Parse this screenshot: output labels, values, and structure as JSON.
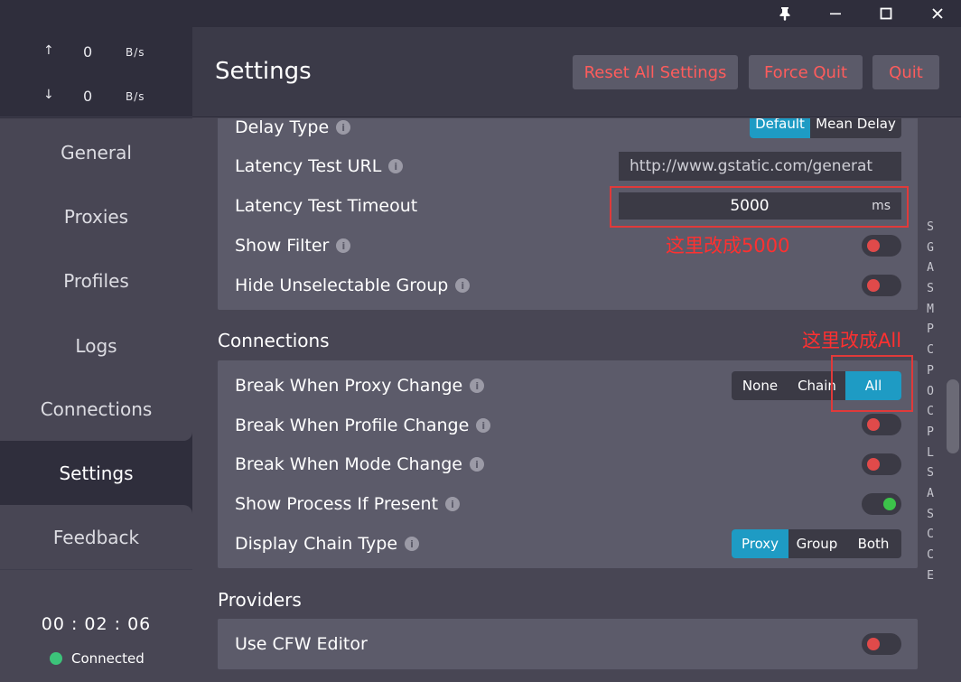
{
  "window": {
    "pin_icon": "pin-icon",
    "minimize_icon": "minimize-icon",
    "maximize_icon": "maximize-icon",
    "close_icon": "close-icon"
  },
  "speed": {
    "upload_arrow": "↑",
    "upload_value": "0",
    "upload_unit": "B/s",
    "download_arrow": "↓",
    "download_value": "0",
    "download_unit": "B/s"
  },
  "nav": {
    "items": [
      "General",
      "Proxies",
      "Profiles",
      "Logs",
      "Connections",
      "Settings",
      "Feedback"
    ],
    "active": "Settings"
  },
  "status": {
    "timer": "00 : 02 : 06",
    "connection": "Connected"
  },
  "header": {
    "title": "Settings",
    "reset_label": "Reset All Settings",
    "force_quit_label": "Force Quit",
    "quit_label": "Quit"
  },
  "general_settings": {
    "delay_type_label": "Delay Type",
    "delay_type_options": [
      "Default",
      "Mean Delay"
    ],
    "delay_type_selected": "Default",
    "latency_url_label": "Latency Test URL",
    "latency_url_value": "http://www.gstatic.com/generat",
    "latency_timeout_label": "Latency Test Timeout",
    "latency_timeout_value": "5000",
    "latency_timeout_unit": "ms",
    "show_filter_label": "Show Filter",
    "show_filter_on": false,
    "hide_unselectable_label": "Hide Unselectable Group",
    "hide_unselectable_on": false
  },
  "connections": {
    "title": "Connections",
    "break_proxy_label": "Break When Proxy Change",
    "break_proxy_options": [
      "None",
      "Chain",
      "All"
    ],
    "break_proxy_selected": "All",
    "break_profile_label": "Break When Profile Change",
    "break_profile_on": false,
    "break_mode_label": "Break When Mode Change",
    "break_mode_on": false,
    "show_process_label": "Show Process If Present",
    "show_process_on": true,
    "chain_type_label": "Display Chain Type",
    "chain_type_options": [
      "Proxy",
      "Group",
      "Both"
    ],
    "chain_type_selected": "Proxy"
  },
  "providers": {
    "title": "Providers",
    "cfw_editor_label": "Use CFW Editor",
    "cfw_editor_on": false
  },
  "annotations": {
    "timeout_note": "这里改成5000",
    "break_note": "这里改成All"
  },
  "index_letters": [
    "S",
    "G",
    "A",
    "S",
    "M",
    "P",
    "C",
    "P",
    "O",
    "C",
    "P",
    "L",
    "S",
    "A",
    "S",
    "C",
    "C",
    "E"
  ],
  "colors": {
    "accent": "#1e9bc4",
    "danger_text": "#ff5c5c",
    "toggle_off": "#e04a4a",
    "toggle_on": "#3cc34a",
    "annotation": "#e03a3a"
  }
}
